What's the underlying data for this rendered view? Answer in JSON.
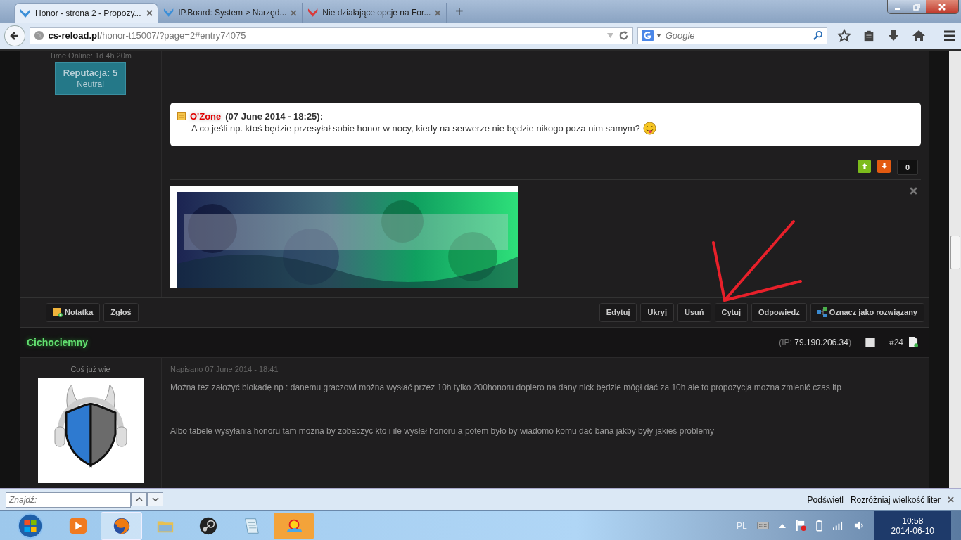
{
  "browser": {
    "tabs": [
      {
        "title": "Honor - strona 2 - Propozy...",
        "selected": true,
        "color": "#3b8fd8"
      },
      {
        "title": "IP.Board: System > Narzęd...",
        "selected": false,
        "color": "#3b8fd8"
      },
      {
        "title": "Nie działające opcje na For...",
        "selected": false,
        "color": "#d83b3b"
      }
    ],
    "new_tab": "+",
    "url_host": "cs-reload.pl",
    "url_path": "/honor-t15007/?page=2#entry74075",
    "search_placeholder": "Google"
  },
  "prev_post": {
    "time_online": "Time Online: 1d 4h 20m",
    "reputation": "Reputacja: 5",
    "reputation_rank": "Neutral",
    "quote": {
      "author": "O'Zone",
      "date": "(07 June 2014 - 18:25):",
      "text": "A co jeśli np. ktoś będzie przesyłał sobie honor w nocy, kiedy na serwerze nie będzie nikogo poza nim samym?"
    },
    "vote_count": "0",
    "left_buttons": [
      {
        "label": "Notatka",
        "kind": "note"
      },
      {
        "label": "Zgłoś",
        "kind": "plain"
      }
    ],
    "right_buttons": [
      {
        "label": "Edytuj",
        "kind": "plain"
      },
      {
        "label": "Ukryj",
        "kind": "plain"
      },
      {
        "label": "Usuń",
        "kind": "plain"
      },
      {
        "label": "Cytuj",
        "kind": "plain"
      },
      {
        "label": "Odpowiedz",
        "kind": "plain"
      },
      {
        "label": "Oznacz jako rozwiązany",
        "kind": "solve"
      }
    ]
  },
  "next_post": {
    "author": "Cichociemny",
    "ip_prefix": "(IP:",
    "ip": "79.190.206.34",
    "ip_suffix": ")",
    "selected": false,
    "number": "#24",
    "rank": "Coś już wie",
    "posted": "Napisano 07 June 2014 - 18:41",
    "paragraphs": [
      "Można tez założyć blokadę np : danemu graczowi  można wysłać przez 10h tylko  200honoru dopiero na dany nick będzie mógł dać za 10h ale to propozycja można zmienić  czas itp",
      "Albo tabele wysyłania honoru tam można by zobaczyć kto i ile wysłał honoru  a  potem było by wiadomo komu dać bana jakby były jakieś problemy"
    ]
  },
  "find_bar": {
    "placeholder": "Znajdź:",
    "highlight": "Podświetl",
    "match_case": "Rozróżniaj wielkość liter"
  },
  "taskbar": {
    "apps": [
      {
        "kind": "media",
        "selected": false
      },
      {
        "kind": "browser",
        "selected": true
      },
      {
        "kind": "folder",
        "selected": false
      },
      {
        "kind": "steam",
        "selected": false
      },
      {
        "kind": "notepad",
        "selected": false
      },
      {
        "kind": "sun",
        "selected": false
      }
    ],
    "language": "PL",
    "time": "10:58",
    "date": "2014-06-10"
  }
}
